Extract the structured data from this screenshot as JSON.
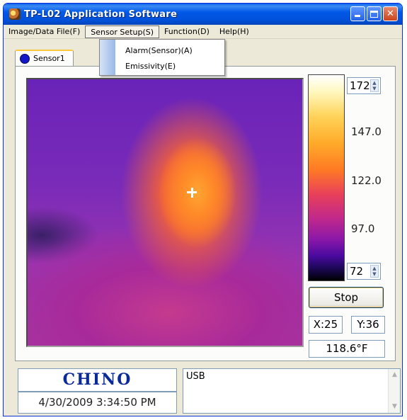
{
  "window": {
    "title": "TP-L02 Application Software"
  },
  "menu": {
    "items": [
      {
        "label": "Image/Data File(F)"
      },
      {
        "label": "Sensor Setup(S)"
      },
      {
        "label": "Function(D)"
      },
      {
        "label": "Help(H)"
      }
    ],
    "dropdown": [
      {
        "label": "Alarm(Sensor)(A)"
      },
      {
        "label": "Emissivity(E)"
      }
    ]
  },
  "tab": {
    "label": "Sensor1"
  },
  "scale": {
    "max_value": "172",
    "min_value": "72",
    "labels": [
      "147.0",
      "122.0",
      "97.0"
    ]
  },
  "controls": {
    "stop_label": "Stop",
    "x_readout": "X:25",
    "y_readout": "Y:36",
    "temperature": "118.6°F"
  },
  "footer": {
    "logo": "CHINO",
    "datetime": "4/30/2009 3:34:50 PM",
    "connection": "USB"
  },
  "colors": {
    "title_bar": "#0058e6",
    "logo": "#0b2a9a",
    "tab_marker": "#1418c8"
  }
}
